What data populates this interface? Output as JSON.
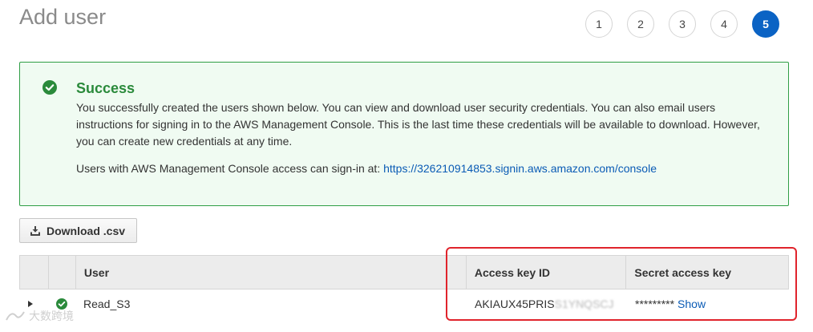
{
  "header": {
    "title": "Add user"
  },
  "steps": {
    "s1": "1",
    "s2": "2",
    "s3": "3",
    "s4": "4",
    "s5": "5",
    "active": "5"
  },
  "success": {
    "title": "Success",
    "message": "You successfully created the users shown below. You can view and download user security credentials. You can also email users instructions for signing in to the AWS Management Console. This is the last time these credentials will be available to download. However, you can create new credentials at any time.",
    "signin_prefix": "Users with AWS Management Console access can sign-in at: ",
    "signin_url": "https://326210914853.signin.aws.amazon.com/console"
  },
  "toolbar": {
    "download_label": "Download .csv"
  },
  "table": {
    "headers": {
      "user": "User",
      "access_key": "Access key ID",
      "secret_key": "Secret access key"
    },
    "rows": [
      {
        "user": "Read_S3",
        "access_key_visible": "AKIAUX45PRIS",
        "access_key_blurred": "S1YNQSCJ",
        "secret_masked": "*********",
        "show_label": "Show"
      }
    ]
  },
  "watermark": {
    "text": "大数跨境"
  },
  "colors": {
    "accent": "#0b63c4",
    "success": "#2a8a3b",
    "highlight": "#e0242c"
  }
}
